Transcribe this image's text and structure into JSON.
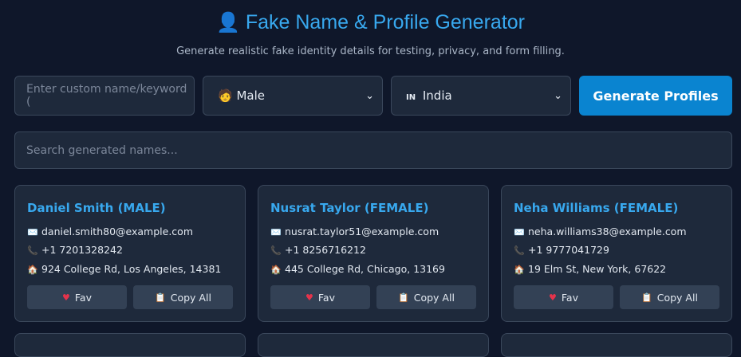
{
  "header": {
    "title": "Fake Name & Profile Generator",
    "title_icon": "👤",
    "subtitle": "Generate realistic fake identity details for testing, privacy, and form filling."
  },
  "controls": {
    "keyword_placeholder": "Enter custom name/keyword (",
    "gender_icon": "🧑",
    "gender_value": "Male",
    "country_flag": "IN",
    "country_value": "India",
    "generate_label": "Generate Profiles"
  },
  "search": {
    "placeholder": "Search generated names..."
  },
  "profiles": [
    {
      "name": "Daniel Smith (MALE)",
      "email": "daniel.smith80@example.com",
      "phone": "+1 7201328242",
      "address": "924 College Rd, Los Angeles, 14381"
    },
    {
      "name": "Nusrat Taylor (FEMALE)",
      "email": "nusrat.taylor51@example.com",
      "phone": "+1 8256716212",
      "address": "445 College Rd, Chicago, 13169"
    },
    {
      "name": "Neha Williams (FEMALE)",
      "email": "neha.williams38@example.com",
      "phone": "+1 9777041729",
      "address": "19 Elm St, New York, 67622"
    }
  ],
  "card_actions": {
    "fav_label": "Fav",
    "copy_label": "Copy All"
  },
  "icons": {
    "email": "envelope-icon",
    "phone": "phone-icon",
    "address": "house-icon",
    "fav": "heart-icon",
    "copy": "clipboard-icon"
  }
}
